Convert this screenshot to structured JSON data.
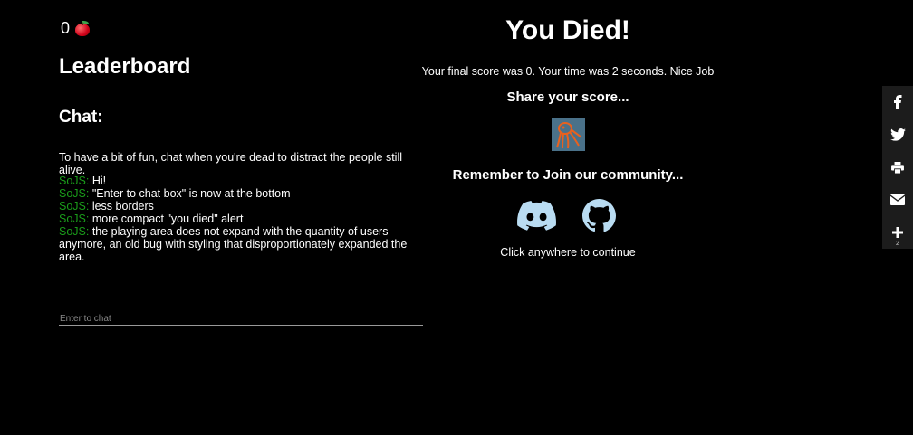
{
  "hud": {
    "score": "0",
    "score_icon": "apple-icon"
  },
  "leaderboard": {
    "title": "Leaderboard"
  },
  "chat": {
    "title": "Chat:",
    "intro": "To have a bit of fun, chat when you're dead to distract the people still alive.",
    "messages": [
      {
        "author": "SoJS:",
        "text": " Hi!"
      },
      {
        "author": "SoJS:",
        "text": " \"Enter to chat box\" is now at the bottom"
      },
      {
        "author": "SoJS:",
        "text": " less borders"
      },
      {
        "author": "SoJS:",
        "text": " more compact \"you died\" alert"
      },
      {
        "author": "SoJS:",
        "text": " the playing area does not expand with the quantity of users anymore, an old bug with styling that disproportionately expanded the area."
      }
    ],
    "input_placeholder": "Enter to chat",
    "author_color": "#1a9c1a"
  },
  "death": {
    "title": "You Died!",
    "final_line": "Your final score was 0. Your time was 2 seconds. Nice Job",
    "share_title": "Share your score...",
    "community_title": "Remember to Join our community...",
    "continue_text": "Click anywhere to continue",
    "community_links": [
      {
        "name": "discord-icon",
        "color": "#b9dcf2"
      },
      {
        "name": "github-icon",
        "color": "#b9dcf2"
      }
    ]
  },
  "share_bar": {
    "buttons": [
      "facebook-icon",
      "twitter-icon",
      "print-icon",
      "email-icon",
      "plus-icon"
    ],
    "plus_count": "2"
  }
}
